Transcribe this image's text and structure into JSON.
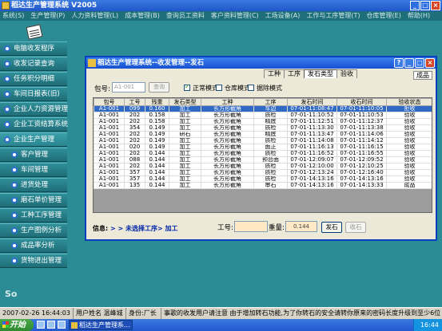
{
  "app": {
    "title": "稻达生产管理系统 V2005",
    "menu": [
      "系统(S)",
      "生产管理(P)",
      "人力资料管理(L)",
      "成本管理(B)",
      "查询员工资料",
      "客户资料管理(C)",
      "工场设备(A)",
      "工作与工序管理(T)",
      "仓库管理(E)",
      "帮助(H)"
    ]
  },
  "sidebar": {
    "items": [
      {
        "label": "电脑收发程序",
        "sub": false
      },
      {
        "label": "收发记录查询",
        "sub": false
      },
      {
        "label": "任务积分明细",
        "sub": false
      },
      {
        "label": "车间日报表(旧)",
        "sub": false
      },
      {
        "label": "企业人力资源管理",
        "sub": false
      },
      {
        "label": "企业工资结算系统",
        "sub": false
      },
      {
        "label": "企业生产管理",
        "sub": false
      },
      {
        "label": "客户管理",
        "sub": true
      },
      {
        "label": "车间管理",
        "sub": true
      },
      {
        "label": "进货处理",
        "sub": true
      },
      {
        "label": "磨石单价管理",
        "sub": true
      },
      {
        "label": "工种工序管理",
        "sub": true
      },
      {
        "label": "生产图例分析",
        "sub": true
      },
      {
        "label": "成品率分析",
        "sub": true
      },
      {
        "label": "货物进出管理",
        "sub": true
      }
    ],
    "logo_text": "So"
  },
  "statusbar": {
    "datetime": "2007-02-26 16:44:03 星期一",
    "user": "用户姓名 温峰城",
    "role": "身份:厂长",
    "notice": "事歌的收发用户请注意  由于增加转石功能,为了你转石的安全请转你原来的密码长度升级到至少6位"
  },
  "taskbar": {
    "start": "开始",
    "task": "稻达生产管理系...",
    "clock": "16:44"
  },
  "dialog": {
    "title": "稻达生产管理系统--收发管理--发石",
    "tabs": [
      "工种",
      "工序",
      "发石类型",
      "验收"
    ],
    "active_tab": 2,
    "extra_tab": "成品",
    "bag_label": "包号:",
    "bag_placeholder": "A1-001",
    "query_label": "查询",
    "modes": [
      {
        "label": "正常模式",
        "checked": true
      },
      {
        "label": "仓库模式",
        "checked": false
      },
      {
        "label": "据除模式",
        "checked": false
      }
    ],
    "columns": [
      "包号",
      "工号",
      "残重",
      "发石类型",
      "工种",
      "工序",
      "发石时间",
      "收石时间",
      "验收状态"
    ],
    "rows": [
      [
        "A1-001",
        "099",
        "0.160",
        "加工",
        "长方形截角",
        "车边",
        "07-01-11:08:47",
        "07-01-11:10:05",
        "拒收"
      ],
      [
        "A1-001",
        "202",
        "0.158",
        "加工",
        "长方形截角",
        "质检",
        "07-01-11:10:52",
        "07-01-11:10:53",
        "验收"
      ],
      [
        "A1-001",
        "202",
        "0.158",
        "加工",
        "长方形截角",
        "精底",
        "07-01-11:12:51",
        "07-01-11:12:37",
        "验收"
      ],
      [
        "A1-001",
        "354",
        "0.149",
        "加工",
        "长方形截角",
        "质检",
        "07-01-11:13:30",
        "07-01-11:13:38",
        "验收"
      ],
      [
        "A1-001",
        "202",
        "0.149",
        "研石",
        "长方形截角",
        "精底",
        "07-01-11:13:47",
        "07-01-11:14:06",
        "验收"
      ],
      [
        "A1-001",
        "202",
        "0.149",
        "加工",
        "长方形截角",
        "质检",
        "07-01-11:14:08",
        "07-01-11:14:12",
        "验收"
      ],
      [
        "A1-001",
        "020",
        "0.149",
        "加工",
        "长方形截角",
        "面正",
        "07-01-11:16:13",
        "07-01-11:16:15",
        "验收"
      ],
      [
        "A1-001",
        "202",
        "0.144",
        "加工",
        "长方形截角",
        "质检",
        "07-01-11:16:52",
        "07-01-11:16:55",
        "验收"
      ],
      [
        "A1-001",
        "088",
        "0.144",
        "加工",
        "长方形截角",
        "预台面",
        "07-01-12:09:07",
        "07-01-12:09:52",
        "验收"
      ],
      [
        "A1-001",
        "202",
        "0.144",
        "加工",
        "长方形截角",
        "质检",
        "07-01-12:10:00",
        "07-01-12:10:25",
        "验收"
      ],
      [
        "A1-001",
        "357",
        "0.144",
        "加工",
        "长方形截角",
        "质检",
        "07-01-12:13:24",
        "07-01-12:16:40",
        "验收"
      ],
      [
        "A1-001",
        "357",
        "0.144",
        "加工",
        "长方形截角",
        "质检",
        "07-01-14:13:16",
        "07-01-14:13:16",
        "验收"
      ],
      [
        "A1-001",
        "135",
        "0.144",
        "加工",
        "长方形截角",
        "审石",
        "07-01-14:13:16",
        "07-01-14:13:33",
        "成品"
      ]
    ],
    "selected_row": 0,
    "info_prefix": "信息:",
    "info_text": "> > 未选择工序> 加工",
    "process_label": "工号:",
    "weight_label": "重量:",
    "weight_value": "0.144",
    "send_label": "发石",
    "receive_label": "收石"
  }
}
